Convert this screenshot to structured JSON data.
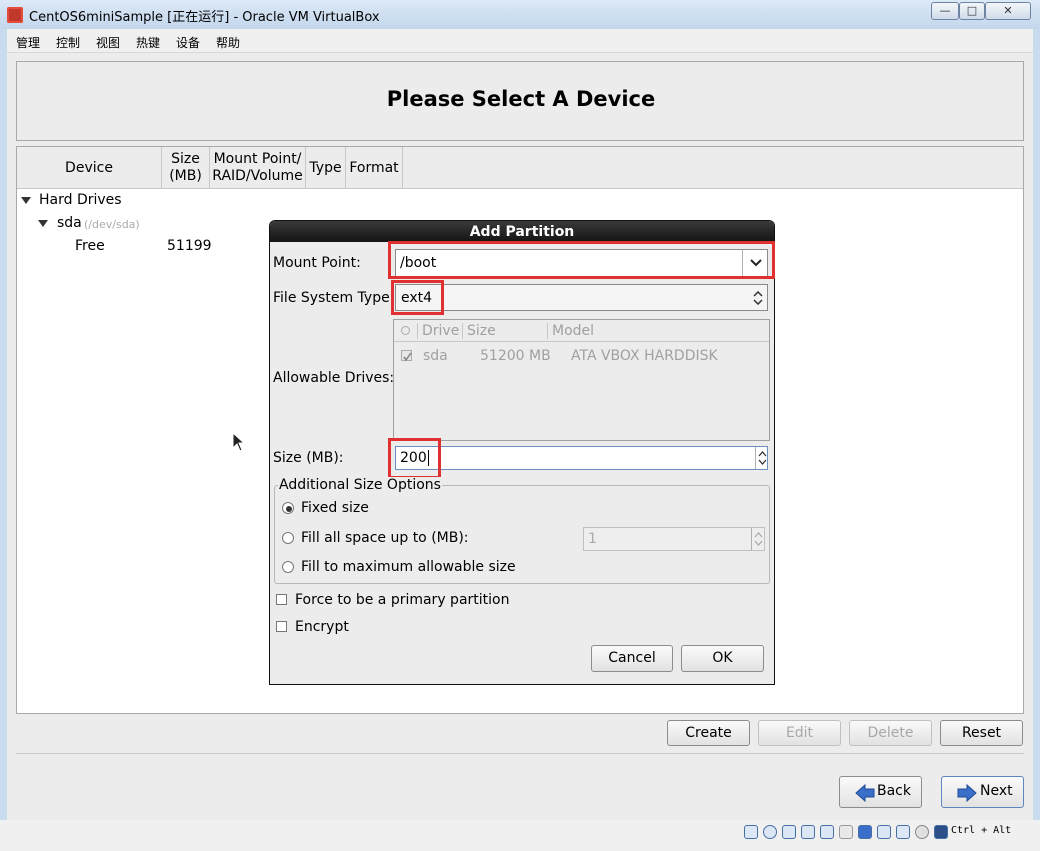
{
  "window": {
    "title": "CentOS6miniSample [正在运行] - Oracle VM VirtualBox",
    "close_glyph": "✕",
    "max_glyph": "□",
    "min_glyph": "—"
  },
  "menu": [
    "管理",
    "控制",
    "视图",
    "热键",
    "设备",
    "帮助"
  ],
  "page_title": "Please Select A Device",
  "table": {
    "columns": [
      "Device",
      "Size\n(MB)",
      "Mount Point/\nRAID/Volume",
      "Type",
      "Format"
    ],
    "tree": {
      "group": "Hard Drives",
      "disk": "sda",
      "disk_path": "(/dev/sda)",
      "free_label": "Free",
      "free_size": "51199"
    }
  },
  "dialog": {
    "title": "Add Partition",
    "mount_point_label": "Mount Point:",
    "mount_point_value": "/boot",
    "fs_type_label": "File System Type:",
    "fs_type_value": "ext4",
    "allowable_drives_label": "Allowable Drives:",
    "drives_columns": [
      "Drive",
      "Size",
      "Model"
    ],
    "drives": [
      {
        "drive": "sda",
        "size": "51200 MB",
        "model": "ATA VBOX HARDDISK",
        "checked": true
      }
    ],
    "size_label": "Size (MB):",
    "size_value": "200",
    "size_options_title": "Additional Size Options",
    "opt_fixed": "Fixed size",
    "opt_fill_upto": "Fill all space up to (MB):",
    "fill_upto_value": "1",
    "opt_fill_max": "Fill to maximum allowable size",
    "force_primary": "Force to be a primary partition",
    "encrypt": "Encrypt",
    "cancel": "Cancel",
    "ok": "OK"
  },
  "actions": {
    "create": "Create",
    "edit": "Edit",
    "delete": "Delete",
    "reset": "Reset"
  },
  "nav": {
    "back": "Back",
    "next": "Next"
  },
  "statusbar": {
    "host_key": "Ctrl + Alt"
  },
  "colors": {
    "highlight_box": "#e03030",
    "nav_arrow": "#3a6fc9"
  }
}
